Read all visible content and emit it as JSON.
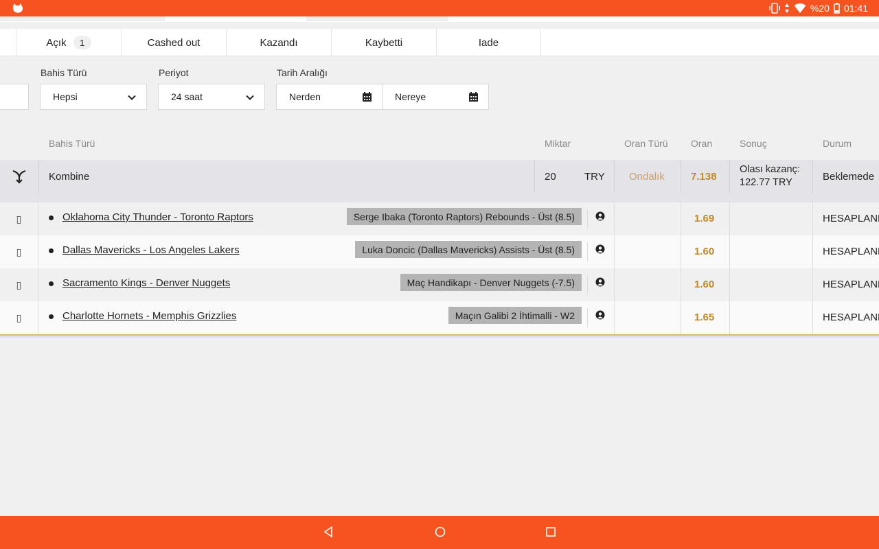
{
  "status_bar": {
    "battery": "%20",
    "time": "01:41"
  },
  "tabs": [
    {
      "label": "Açık",
      "count": "1"
    },
    {
      "label": "Cashed out"
    },
    {
      "label": "Kazandı"
    },
    {
      "label": "Kaybetti"
    },
    {
      "label": "Iade"
    }
  ],
  "filters": {
    "bet_type_label": "Bahis Türü",
    "bet_type_value": "Hepsi",
    "period_label": "Periyot",
    "period_value": "24 saat",
    "date_range_label": "Tarih Aralığı",
    "from_placeholder": "Nerden",
    "to_placeholder": "Nereye"
  },
  "table": {
    "headers": {
      "bet_type": "Bahis Türü",
      "amount": "Miktar",
      "odds_type": "Oran Türü",
      "odds": "Oran",
      "result": "Sonuç",
      "state": "Durum"
    },
    "bet": {
      "type": "Kombine",
      "amount": "20",
      "currency": "TRY",
      "odds_type": "Ondalık",
      "odds": "7.138",
      "result_line1": "Olası kazanç:",
      "result_line2": "122.77 TRY",
      "state": "Beklemede"
    },
    "selections": [
      {
        "icon": "▯",
        "event": "Oklahoma City Thunder - Toronto Raptors",
        "pick": "Serge Ibaka (Toronto Raptors) Rebounds - Üst (8.5)",
        "odds": "1.69",
        "status": "HESAPLANM"
      },
      {
        "icon": "▯",
        "event": "Dallas Mavericks - Los Angeles Lakers",
        "pick": "Luka Doncic (Dallas Mavericks) Assists - Üst (8.5)",
        "odds": "1.60",
        "status": "HESAPLANM"
      },
      {
        "icon": "▯",
        "event": "Sacramento Kings - Denver Nuggets",
        "pick": "Maç Handikapı - Denver Nuggets (-7.5)",
        "odds": "1.60",
        "status": "HESAPLANM"
      },
      {
        "icon": "▯",
        "event": "Charlotte Hornets - Memphis Grizzlies",
        "pick": "Maçın Galibi 2 İhtimalli - W2",
        "odds": "1.65",
        "status": "HESAPLANM"
      }
    ]
  },
  "colors": {
    "brand": "#f55420",
    "odds_gold": "#c08a2c",
    "odds_type": "#c8a070"
  }
}
